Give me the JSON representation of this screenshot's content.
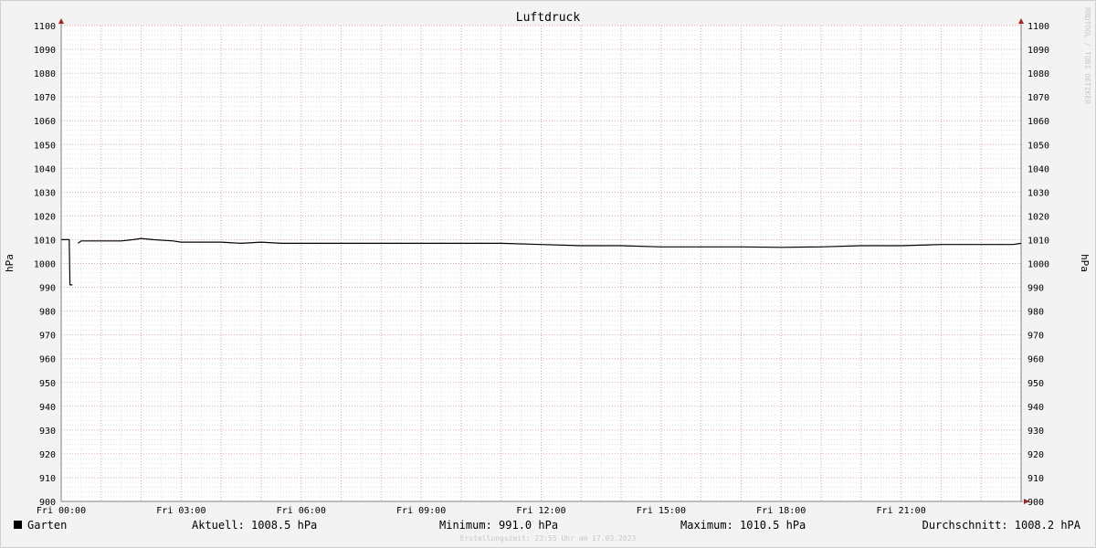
{
  "chart_data": {
    "type": "line",
    "title": "Luftdruck",
    "ylabel_left": "hPa",
    "ylabel_right": "hPa",
    "ylim": [
      900,
      1100
    ],
    "y_ticks": [
      900,
      910,
      920,
      930,
      940,
      950,
      960,
      970,
      980,
      990,
      1000,
      1010,
      1020,
      1030,
      1040,
      1050,
      1060,
      1070,
      1080,
      1090,
      1100
    ],
    "x_range_hours": [
      0,
      24
    ],
    "x_ticks": [
      {
        "hour": 0,
        "label": "Fri 00:00"
      },
      {
        "hour": 3,
        "label": "Fri 03:00"
      },
      {
        "hour": 6,
        "label": "Fri 06:00"
      },
      {
        "hour": 9,
        "label": "Fri 09:00"
      },
      {
        "hour": 12,
        "label": "Fri 12:00"
      },
      {
        "hour": 15,
        "label": "Fri 15:00"
      },
      {
        "hour": 18,
        "label": "Fri 18:00"
      },
      {
        "hour": 21,
        "label": "Fri 21:00"
      }
    ],
    "grid": true,
    "series": [
      {
        "name": "Garten",
        "color": "#000000",
        "segments": [
          [
            [
              0.0,
              1010.0
            ],
            [
              0.2,
              1010.0
            ],
            [
              0.22,
              991.0
            ],
            [
              0.28,
              991.0
            ]
          ],
          [
            [
              0.42,
              1008.5
            ],
            [
              0.5,
              1009.5
            ],
            [
              1.0,
              1009.5
            ],
            [
              1.5,
              1009.5
            ],
            [
              1.8,
              1010.0
            ],
            [
              2.0,
              1010.5
            ],
            [
              2.3,
              1010.0
            ],
            [
              2.8,
              1009.5
            ],
            [
              3.0,
              1009.0
            ],
            [
              4.0,
              1009.0
            ],
            [
              4.5,
              1008.5
            ],
            [
              5.0,
              1009.0
            ],
            [
              5.5,
              1008.5
            ],
            [
              6.0,
              1008.5
            ],
            [
              6.5,
              1008.5
            ],
            [
              7.0,
              1008.5
            ],
            [
              8.0,
              1008.5
            ],
            [
              9.0,
              1008.5
            ],
            [
              10.0,
              1008.5
            ],
            [
              11.0,
              1008.5
            ],
            [
              12.0,
              1008.0
            ],
            [
              13.0,
              1007.5
            ],
            [
              14.0,
              1007.5
            ],
            [
              15.0,
              1007.0
            ],
            [
              16.0,
              1007.0
            ],
            [
              17.0,
              1007.0
            ],
            [
              18.0,
              1006.8
            ],
            [
              19.0,
              1007.0
            ],
            [
              20.0,
              1007.5
            ],
            [
              21.0,
              1007.5
            ],
            [
              22.0,
              1008.0
            ],
            [
              23.0,
              1008.0
            ],
            [
              23.8,
              1008.0
            ],
            [
              24.0,
              1008.5
            ]
          ]
        ]
      }
    ]
  },
  "legend": {
    "series_name": "Garten",
    "current": "Aktuell: 1008.5 hPa",
    "minimum": "Minimum: 991.0 hPa",
    "maximum": "Maximum: 1010.5 hPa",
    "average": "Durchschnitt: 1008.2 hPA"
  },
  "watermark": "RRDTOOL / TOBI OETIKER",
  "footer": "Erstellungszeit: 23:55 Uhr am 17.03.2023"
}
